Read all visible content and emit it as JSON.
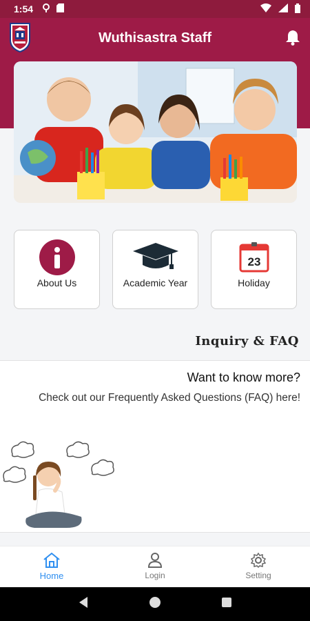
{
  "status_bar": {
    "time": "1:54"
  },
  "header": {
    "title": "Wuthisastra Staff"
  },
  "tiles": [
    {
      "label": "About Us",
      "icon": "info-icon"
    },
    {
      "label": "Academic Year",
      "icon": "graduation-cap-icon"
    },
    {
      "label": "Holiday",
      "icon": "calendar-icon",
      "calendar_day": "23"
    }
  ],
  "faq": {
    "section_title": "Inquiry & FAQ",
    "heading": "Want to know more?",
    "text": "Check out our Frequently Asked Questions (FAQ) here!"
  },
  "bottom_nav": [
    {
      "label": "Home",
      "icon": "home-icon",
      "active": true
    },
    {
      "label": "Login",
      "icon": "user-icon",
      "active": false
    },
    {
      "label": "Setting",
      "icon": "gear-icon",
      "active": false
    }
  ],
  "colors": {
    "brand": "#9e1b47",
    "status_bar": "#8e1b3d",
    "active_nav": "#2f8ff0"
  }
}
